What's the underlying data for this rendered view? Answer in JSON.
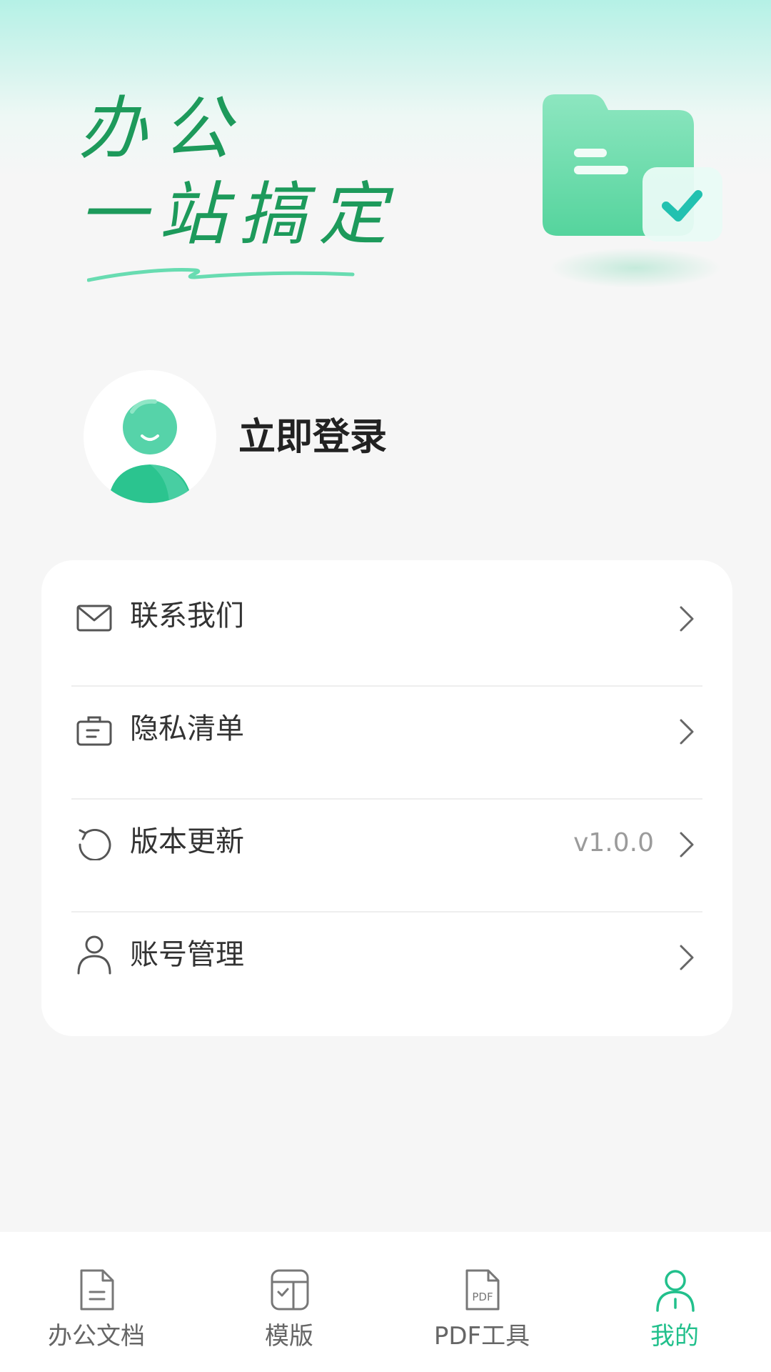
{
  "hero": {
    "slogan_line1": "办公",
    "slogan_line2": "一站搞定"
  },
  "profile": {
    "login_label": "立即登录"
  },
  "menu": {
    "items": [
      {
        "label": "联系我们",
        "icon": "mail-icon",
        "value": ""
      },
      {
        "label": "隐私清单",
        "icon": "privacy-list-icon",
        "value": ""
      },
      {
        "label": "版本更新",
        "icon": "refresh-icon",
        "value": "v1.0.0"
      },
      {
        "label": "账号管理",
        "icon": "user-icon",
        "value": ""
      }
    ]
  },
  "tabbar": {
    "tabs": [
      {
        "label": "办公文档",
        "icon": "document-icon",
        "active": false
      },
      {
        "label": "模版",
        "icon": "template-icon",
        "active": false
      },
      {
        "label": "PDF工具",
        "icon": "pdf-icon",
        "active": false
      },
      {
        "label": "我的",
        "icon": "profile-icon",
        "active": true
      }
    ]
  },
  "colors": {
    "accent": "#22c08c",
    "slogan": "#1d9a5b",
    "background": "#f6f6f6",
    "card": "#ffffff"
  }
}
